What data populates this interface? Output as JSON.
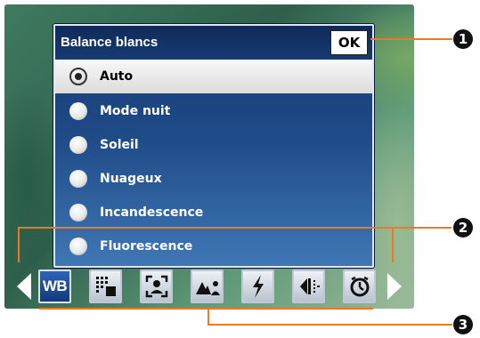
{
  "dialog": {
    "title": "Balance blancs",
    "ok_label": "OK",
    "options": [
      {
        "label": "Auto",
        "selected": true
      },
      {
        "label": "Mode nuit",
        "selected": false
      },
      {
        "label": "Soleil",
        "selected": false
      },
      {
        "label": "Nuageux",
        "selected": false
      },
      {
        "label": "Incandescence",
        "selected": false
      },
      {
        "label": "Fluorescence",
        "selected": false
      }
    ]
  },
  "toolbar": {
    "items": [
      {
        "name": "white-balance",
        "label": "WB",
        "active": true
      },
      {
        "name": "metering-grid-icon"
      },
      {
        "name": "portrait-frame-icon"
      },
      {
        "name": "scene-mode-icon"
      },
      {
        "name": "flash-icon"
      },
      {
        "name": "exposure-icon"
      },
      {
        "name": "self-timer-icon"
      }
    ]
  },
  "callouts": [
    "1",
    "2",
    "3"
  ],
  "colors": {
    "accent_line": "#f07820",
    "dialog_blue": "#1e4a86",
    "active_button": "#2f64b6"
  }
}
